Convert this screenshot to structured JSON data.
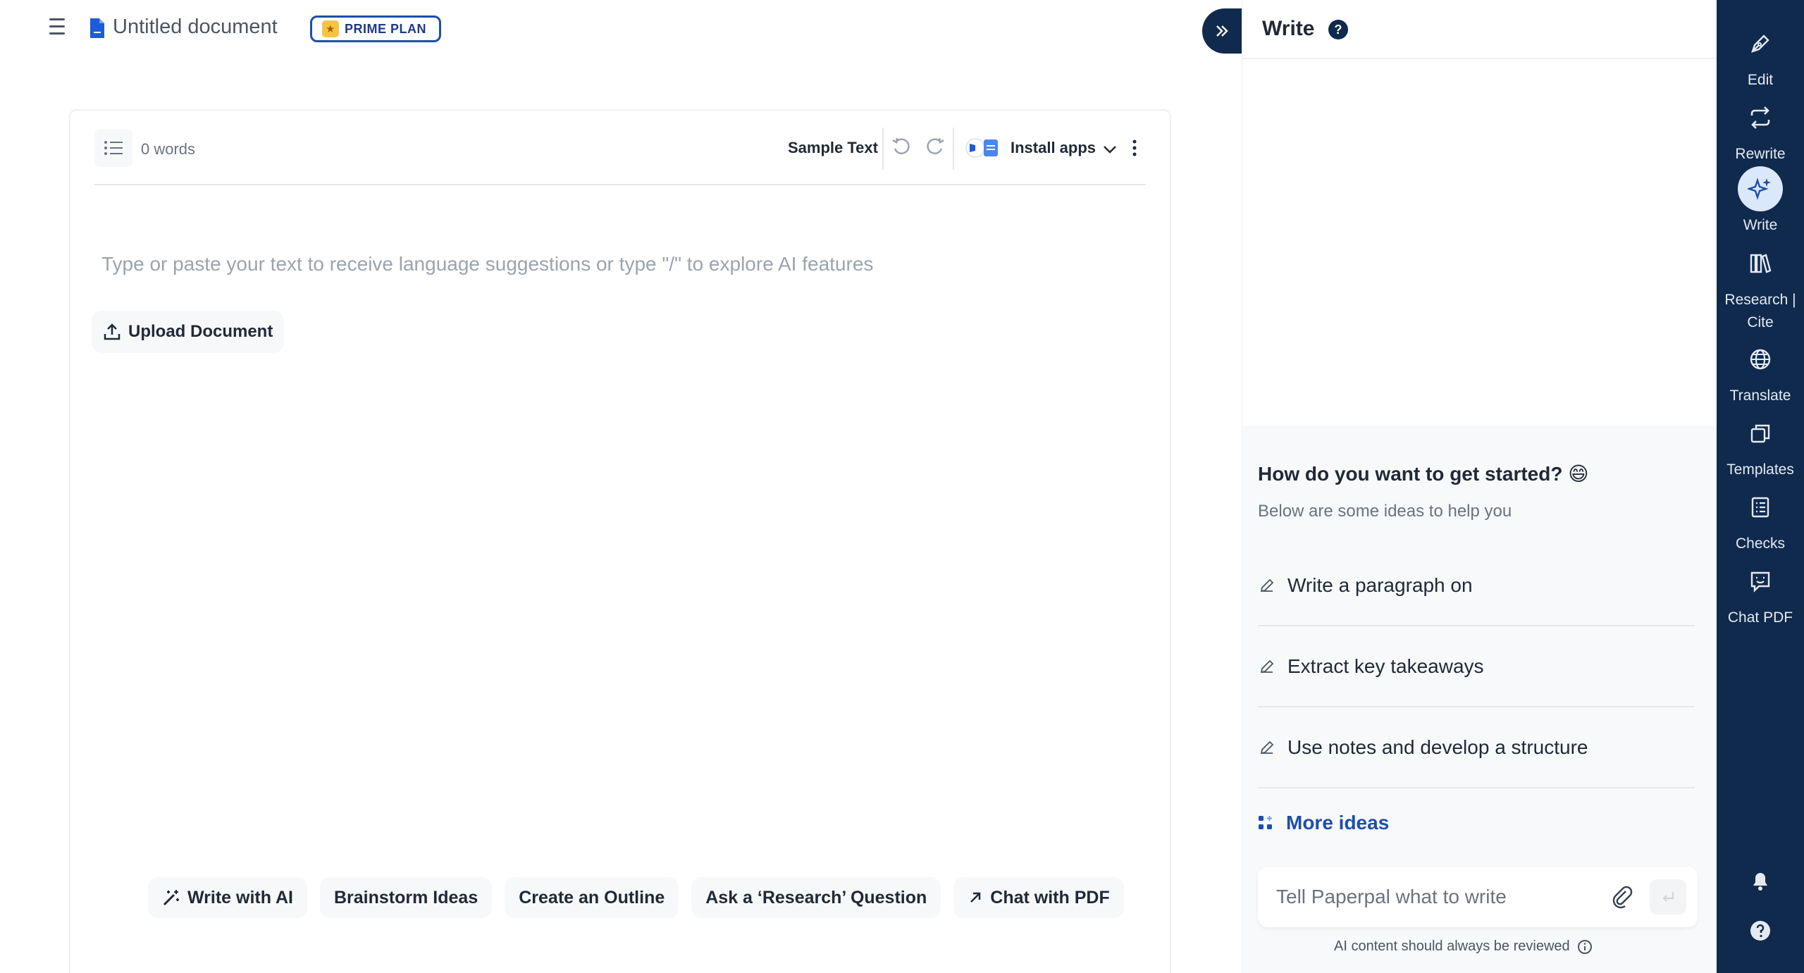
{
  "header": {
    "doc_title": "Untitled document",
    "plan_badge": "PRIME PLAN"
  },
  "editor": {
    "word_count": "0 words",
    "sample_text": "Sample Text",
    "install_apps": "Install apps",
    "placeholder": "Type or paste your text to receive language suggestions or type \"/\" to explore AI features",
    "upload_label": "Upload Document",
    "chips": [
      {
        "label": "Write with AI",
        "icon": "magic-wand-icon"
      },
      {
        "label": "Brainstorm Ideas"
      },
      {
        "label": "Create an Outline"
      },
      {
        "label": "Ask a ‘Research’ Question"
      },
      {
        "label": "Chat with PDF",
        "icon": "arrow-up-right-icon"
      }
    ]
  },
  "panel": {
    "title": "Write",
    "help": "?",
    "started_title": "How do you want to get started? 😄",
    "started_sub": "Below are some ideas to help you",
    "ideas": [
      {
        "label": "Write a paragraph on"
      },
      {
        "label": "Extract key takeaways"
      },
      {
        "label": "Use notes and develop a structure"
      }
    ],
    "more_ideas": "More ideas",
    "prompt_placeholder": "Tell Paperpal what to write",
    "disclaimer": "AI content should always be reviewed"
  },
  "rail": {
    "items": [
      {
        "label": "Edit",
        "icon": "pen-nib-icon"
      },
      {
        "label": "Rewrite",
        "icon": "repeat-icon"
      },
      {
        "label": "Write",
        "icon": "sparkle-icon",
        "active": true
      },
      {
        "label": "Research | Cite",
        "icon": "books-icon"
      },
      {
        "label": "Translate",
        "icon": "globe-icon"
      },
      {
        "label": "Templates",
        "icon": "copy-icon"
      },
      {
        "label": "Checks",
        "icon": "checklist-icon"
      },
      {
        "label": "Chat PDF",
        "icon": "chat-doc-icon"
      }
    ]
  },
  "colors": {
    "navy": "#0f2a4d",
    "accent_blue": "#1e4fa8",
    "active_bg": "#dbe7fb",
    "muted_text": "#6b7280"
  }
}
